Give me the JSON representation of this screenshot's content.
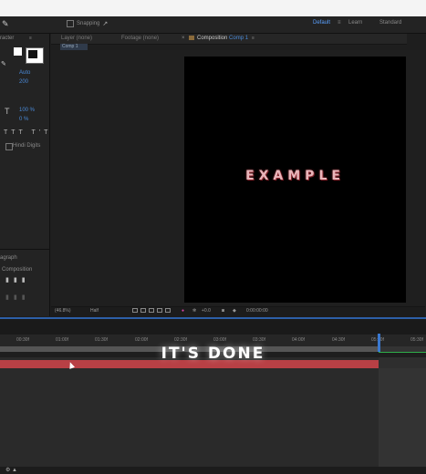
{
  "toolbar": {
    "snapping_label": "Snapping"
  },
  "workspaces": {
    "default": "Default",
    "learn": "Learn",
    "standard": "Standard"
  },
  "left_panel": {
    "title_fragment": "racter",
    "font_size_auto": "Auto",
    "value_200": "200",
    "scale_v": "100 %",
    "baseline": "0 %",
    "hindi_digits": "Hindi Digits",
    "paragraph_fragment": "agraph",
    "composition_label": "Composition"
  },
  "panel_tabs": {
    "layer": "Layer (none)",
    "footage": "Footage (none)",
    "composition": "Composition",
    "composition_name": "Comp 1",
    "comp_chip": "Comp 1"
  },
  "canvas_text": "EXAMPLE",
  "viewer": {
    "zoom": "(46.8%)",
    "resolution": "Half",
    "exposure": "+0.0",
    "timecode": "0:00:00:00"
  },
  "timeline": {
    "ticks": [
      "00:30f",
      "01:00f",
      "01:30f",
      "02:00f",
      "02:30f",
      "03:00f",
      "03:30f",
      "04:00f",
      "04:30f",
      "05:00f",
      "05:30f"
    ]
  },
  "overlay_text": "IT'S DONE",
  "colors": {
    "accent_blue": "#4a8ad8",
    "layer_red": "#b84045",
    "text_pink": "#e8b5ba",
    "cti_blue": "#3a78d0",
    "green": "#2fae4a"
  }
}
